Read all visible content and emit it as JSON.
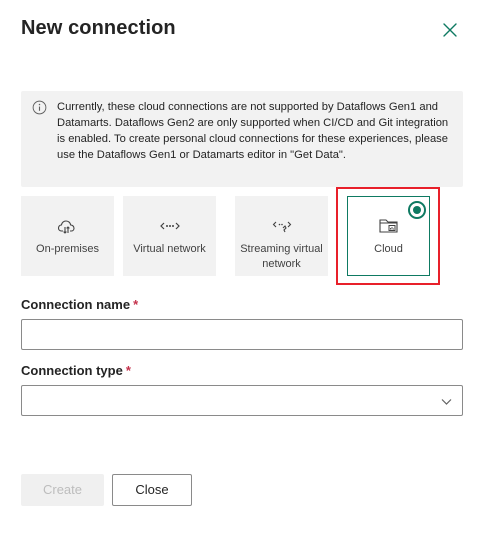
{
  "dialog": {
    "title": "New connection",
    "close_icon": "close-icon"
  },
  "banner": {
    "icon": "info-icon",
    "text": "Currently, these cloud connections are not supported by Dataflows Gen1 and Datamarts. Dataflows Gen2 are only supported when CI/CD and Git integration is enabled. To create personal cloud connections for these experiences, please use the Dataflows Gen1 or Datamarts editor in \"Get Data\"."
  },
  "connection_kinds": [
    {
      "label": "On-premises",
      "icon": "cloud-gateway-icon",
      "selected": false
    },
    {
      "label": "Virtual network",
      "icon": "virtual-network-icon",
      "selected": false
    },
    {
      "label": "Streaming virtual network",
      "icon": "streaming-network-icon",
      "selected": false
    },
    {
      "label": "Cloud",
      "icon": "cloud-folder-icon",
      "selected": true
    }
  ],
  "form": {
    "connection_name": {
      "label": "Connection name",
      "required_mark": "*",
      "value": "",
      "placeholder": ""
    },
    "connection_type": {
      "label": "Connection type",
      "required_mark": "*",
      "value": ""
    }
  },
  "buttons": {
    "create": "Create",
    "close": "Close"
  },
  "colors": {
    "accent": "#0e7a62",
    "highlight_outline": "#e8202a",
    "required": "#c4314b",
    "banner_bg": "#f2f2f2"
  }
}
